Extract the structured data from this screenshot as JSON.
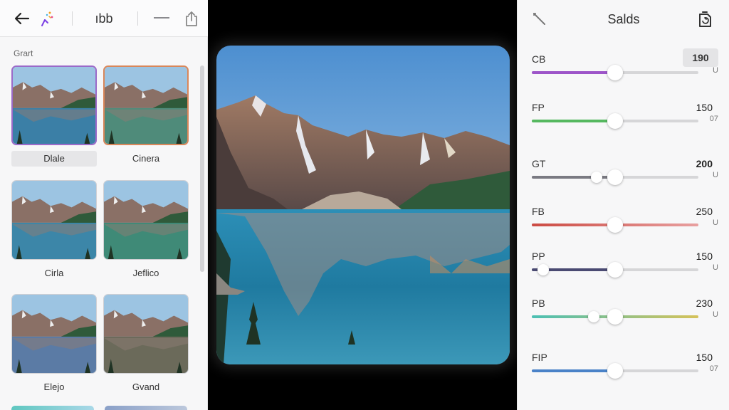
{
  "left_panel": {
    "topbar_title": "ıbb",
    "section_label": "Grart",
    "presets": [
      {
        "label": "Dlale",
        "tint": "#3b7fa6"
      },
      {
        "label": "Cinera",
        "tint": "#4f8b7a"
      },
      {
        "label": "Cirla",
        "tint": "#3c86a8"
      },
      {
        "label": "Jeflico",
        "tint": "#3f8a77"
      },
      {
        "label": "Elejo",
        "tint": "#5b7ba5"
      },
      {
        "label": "Gvand",
        "tint": "#6b6a5a"
      }
    ]
  },
  "right_panel": {
    "title": "Salds",
    "adjustments": [
      {
        "name": "CB",
        "value": "190",
        "sub": "U",
        "level": 0.5,
        "fill": "#9d55c9",
        "boxed": true,
        "bold": true
      },
      {
        "name": "FP",
        "value": "150",
        "sub": "07",
        "level": 0.5,
        "fill": "#56b860",
        "boxed": false,
        "bold": false
      },
      {
        "name": "GT",
        "value": "200",
        "sub": "U",
        "level": 0.5,
        "fill": "#7a7a82",
        "boxed": false,
        "bold": true,
        "second_level": 0.39
      },
      {
        "name": "FB",
        "value": "250",
        "sub": "U",
        "level": 0.5,
        "fill": "#cc4b43",
        "boxed": false,
        "bold": false
      },
      {
        "name": "PP",
        "value": "150",
        "sub": "U",
        "level": 0.5,
        "fill": "#4a4a72",
        "boxed": false,
        "bold": false,
        "second_level": 0.07
      },
      {
        "name": "PB",
        "value": "230",
        "sub": "U",
        "level": 0.5,
        "fill": "#4bc0b4",
        "boxed": false,
        "bold": false,
        "second_level": 0.37
      },
      {
        "name": "FIP",
        "value": "150",
        "sub": "07",
        "level": 0.5,
        "fill": "#4a82c8",
        "boxed": false,
        "bold": false
      }
    ]
  },
  "icons": {
    "back": "arrow-left-icon",
    "sparkle": "sparkle-icon",
    "minimize": "minus-icon",
    "share": "share-icon",
    "wand": "wand-icon",
    "save": "save-icon"
  },
  "colors": {
    "panel_bg": "#f7f7f8",
    "canvas_bg": "#000000",
    "preset_selected_purple": "#9b6ac9",
    "preset_selected_orange": "#d9875a"
  }
}
